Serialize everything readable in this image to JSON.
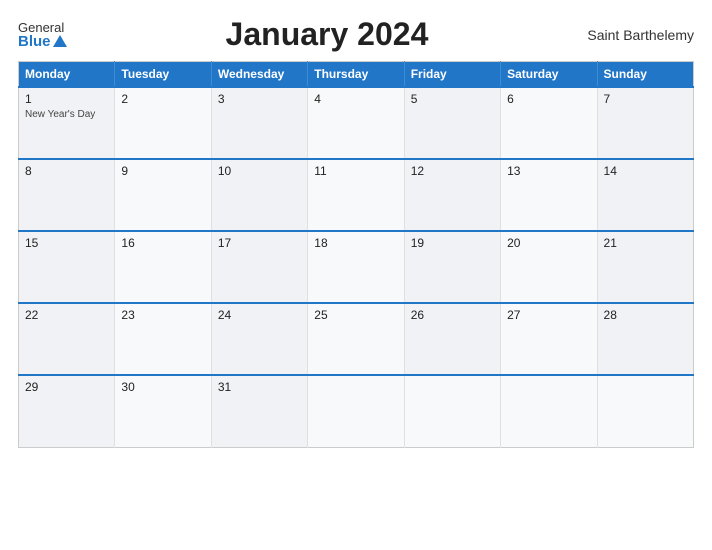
{
  "header": {
    "logo_general": "General",
    "logo_blue": "Blue",
    "title": "January 2024",
    "region": "Saint Barthelemy"
  },
  "calendar": {
    "weekdays": [
      "Monday",
      "Tuesday",
      "Wednesday",
      "Thursday",
      "Friday",
      "Saturday",
      "Sunday"
    ],
    "weeks": [
      [
        {
          "day": "1",
          "events": [
            "New Year's Day"
          ]
        },
        {
          "day": "2",
          "events": []
        },
        {
          "day": "3",
          "events": []
        },
        {
          "day": "4",
          "events": []
        },
        {
          "day": "5",
          "events": []
        },
        {
          "day": "6",
          "events": []
        },
        {
          "day": "7",
          "events": []
        }
      ],
      [
        {
          "day": "8",
          "events": []
        },
        {
          "day": "9",
          "events": []
        },
        {
          "day": "10",
          "events": []
        },
        {
          "day": "11",
          "events": []
        },
        {
          "day": "12",
          "events": []
        },
        {
          "day": "13",
          "events": []
        },
        {
          "day": "14",
          "events": []
        }
      ],
      [
        {
          "day": "15",
          "events": []
        },
        {
          "day": "16",
          "events": []
        },
        {
          "day": "17",
          "events": []
        },
        {
          "day": "18",
          "events": []
        },
        {
          "day": "19",
          "events": []
        },
        {
          "day": "20",
          "events": []
        },
        {
          "day": "21",
          "events": []
        }
      ],
      [
        {
          "day": "22",
          "events": []
        },
        {
          "day": "23",
          "events": []
        },
        {
          "day": "24",
          "events": []
        },
        {
          "day": "25",
          "events": []
        },
        {
          "day": "26",
          "events": []
        },
        {
          "day": "27",
          "events": []
        },
        {
          "day": "28",
          "events": []
        }
      ],
      [
        {
          "day": "29",
          "events": []
        },
        {
          "day": "30",
          "events": []
        },
        {
          "day": "31",
          "events": []
        },
        {
          "day": "",
          "events": []
        },
        {
          "day": "",
          "events": []
        },
        {
          "day": "",
          "events": []
        },
        {
          "day": "",
          "events": []
        }
      ]
    ]
  }
}
